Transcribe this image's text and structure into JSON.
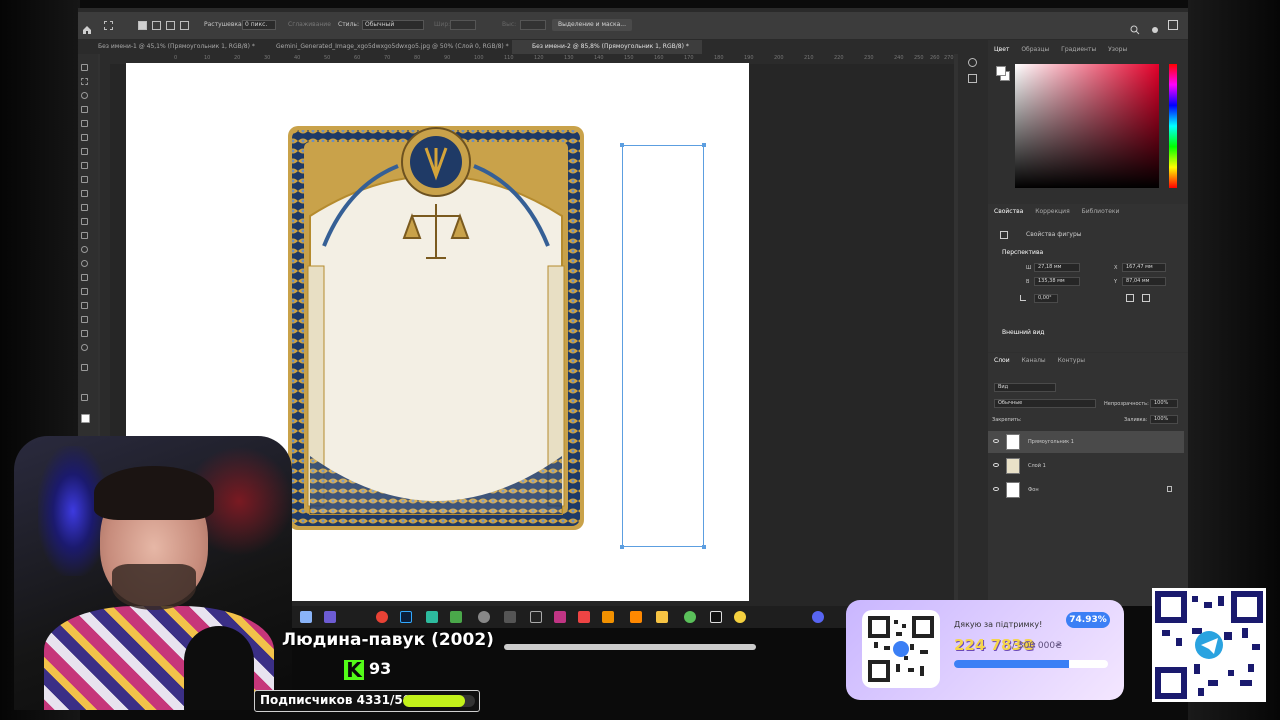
{
  "photoshop": {
    "options_bar": {
      "feather_label": "Растушевка:",
      "feather_value": "0 пикс.",
      "smoothing_label": "Сглаживание",
      "style_label": "Стиль:",
      "style_value": "Обычный",
      "width_label": "Шир:",
      "height_label": "Выс:",
      "select_mask_button": "Выделение и маска..."
    },
    "tabs": [
      "Без имени-1 @ 45,1% (Прямоугольник 1, RGB/8) *",
      "Gemini_Generated_Image_xgo5dwxgo5dwxgo5.jpg @ 50% (Слой 0, RGB/8) *",
      "Без имени-2 @ 85,8% (Прямоугольник 1, RGB/8) *"
    ],
    "active_tab_index": 2,
    "ruler_numbers": [
      "0",
      "10",
      "20",
      "30",
      "40",
      "50",
      "60",
      "70",
      "80",
      "90",
      "100",
      "110",
      "120",
      "130",
      "140",
      "150",
      "160",
      "170",
      "180",
      "190",
      "200",
      "210",
      "220",
      "230",
      "240",
      "250",
      "260",
      "270"
    ],
    "color_panel": {
      "tabs": [
        "Цвет",
        "Образцы",
        "Градиенты",
        "Узоры"
      ],
      "foreground": "#ffffff",
      "hue_color": "#e4002a"
    },
    "properties_panel": {
      "tabs": [
        "Свойства",
        "Коррекция",
        "Библиотеки"
      ],
      "subtitle": "Свойства фигуры",
      "section_perspective": "Перспектива",
      "w_label": "Ш",
      "w_value": "27,18 мм",
      "h_label": "В",
      "h_value": "135,38 мм",
      "x_label": "X",
      "x_value": "167,47 мм",
      "y_label": "Y",
      "y_value": "87,04 мм",
      "angle_value": "0,00°",
      "section_appearance": "Внешний вид"
    },
    "layers_panel": {
      "tabs": [
        "Слои",
        "Каналы",
        "Контуры"
      ],
      "filter_label": "Вид",
      "blend_mode": "Обычные",
      "opacity_label": "Непрозрачность:",
      "opacity_value": "100%",
      "lock_label": "Закрепить:",
      "fill_label": "Заливка:",
      "fill_value": "100%",
      "layers": [
        {
          "name": "Прямоугольник 1",
          "selected": true,
          "locked": false
        },
        {
          "name": "Слой 1",
          "selected": false,
          "locked": false
        },
        {
          "name": "Фон",
          "selected": false,
          "locked": true
        }
      ]
    }
  },
  "taskbar": {
    "icons": [
      "windows-icon",
      "widgets-icon",
      "chrome-icon",
      "photoshop-icon",
      "app-icon",
      "app-icon",
      "clock-icon",
      "app-icon",
      "app-icon",
      "instagram-icon",
      "app-icon",
      "app-icon",
      "vlc-icon",
      "folder-icon",
      "app-icon",
      "app-icon",
      "app-icon",
      "discord-icon"
    ]
  },
  "stream": {
    "title": "Людина-павук (2002)",
    "platform_glyph": "K",
    "viewers": "93",
    "subscribers_text": "Подписчиков 4331/5000",
    "subscribers_progress": 0.8662,
    "accent_kick": "#53fc18",
    "accent_subs": "#c3f21a"
  },
  "donation": {
    "label": "Дякую за підтримку!",
    "amount": "224 783₴",
    "goal": "/ 300 000₴",
    "percent": "74.93%",
    "progress": 0.7493,
    "accent": "#3b7ff5"
  }
}
